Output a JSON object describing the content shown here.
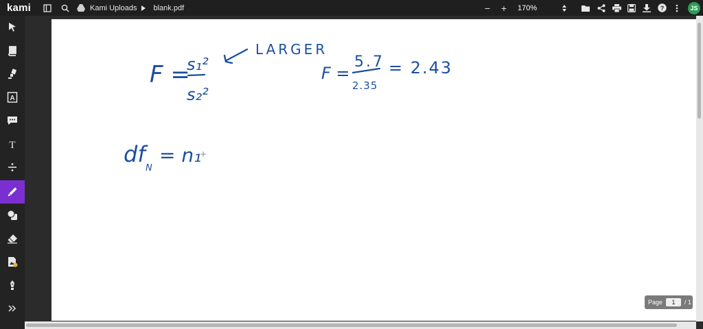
{
  "app": {
    "logo": "kami",
    "breadcrumb": {
      "folder": "Kami Uploads",
      "file": "blank.pdf"
    }
  },
  "toolbar": {
    "zoom_out": "−",
    "zoom_in": "+",
    "zoom_value": "170%",
    "avatar_initials": "JS"
  },
  "sidebar": {
    "tools": [
      {
        "name": "select-tool",
        "icon": "cursor-arrow"
      },
      {
        "name": "dictionary-tool",
        "icon": "book"
      },
      {
        "name": "highlight-tool",
        "icon": "highlighter"
      },
      {
        "name": "markup-tool",
        "icon": "text-markup"
      },
      {
        "name": "comment-tool",
        "icon": "speech-bubble"
      },
      {
        "name": "text-tool",
        "icon": "letter-t"
      },
      {
        "name": "equation-tool",
        "icon": "divide"
      },
      {
        "name": "drawing-tool",
        "icon": "pen",
        "active": true
      },
      {
        "name": "shapes-tool",
        "icon": "shapes"
      },
      {
        "name": "eraser-tool",
        "icon": "eraser"
      },
      {
        "name": "add-media-tool",
        "icon": "image-plus"
      },
      {
        "name": "signature-tool",
        "icon": "pen-nib"
      },
      {
        "name": "expand-tool",
        "icon": "double-chevron"
      }
    ]
  },
  "page": {
    "indicator_label": "Page",
    "current_page": "1",
    "total_pages": "/ 1"
  },
  "handwriting": {
    "f_formula_lhs": "F =",
    "numerator": "s₁²",
    "denominator": "s₂²",
    "arrow_note": "LARGER",
    "f_calc_lhs": "F =",
    "calc_numerator": "5.7",
    "calc_denominator": "2.35",
    "calc_result": "= 2.43",
    "df_lhs": "df",
    "df_sub": "N",
    "df_rhs": "= n₁"
  },
  "colors": {
    "ink": "#1b4fa0",
    "active_tool": "#7b2fd1",
    "avatar": "#2e9d55"
  }
}
